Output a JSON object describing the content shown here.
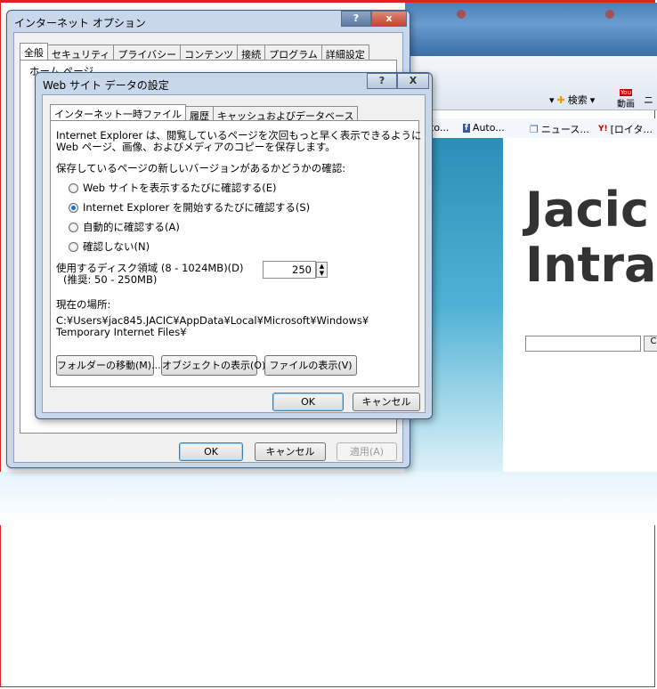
{
  "browser": {
    "cmd_search": "検索",
    "cmd_video": "動画",
    "cmd_more": "ニ",
    "favorites": [
      "to...",
      "Auto...",
      "ニュース...",
      "[ロイタ..."
    ],
    "hero_line1": "Jacic",
    "hero_line2": "Intrar",
    "search_button": "C"
  },
  "internet_options": {
    "title": "インターネット オプション",
    "help": "?",
    "close": "x",
    "tabs": [
      "全般",
      "セキュリティ",
      "プライバシー",
      "コンテンツ",
      "接続",
      "プログラム",
      "詳細設定"
    ],
    "homepage_label": "ホーム ページ",
    "ok": "OK",
    "cancel": "キャンセル",
    "apply": "適用(A)"
  },
  "site_data": {
    "title": "Web サイト データの設定",
    "help": "?",
    "close": "X",
    "tabs": [
      "インターネット一時ファイル",
      "履歴",
      "キャッシュおよびデータベース"
    ],
    "desc_line1": "Internet Explorer は、閲覧しているページを次回もっと早く表示できるように",
    "desc_line2": "Web ページ、画像、およびメディアのコピーを保存します。",
    "check_label": "保存しているページの新しいバージョンがあるかどうかの確認:",
    "options": [
      {
        "label": "Web サイトを表示するたびに確認する(E)",
        "selected": false
      },
      {
        "label": "Internet Explorer を開始するたびに確認する(S)",
        "selected": true
      },
      {
        "label": "自動的に確認する(A)",
        "selected": false
      },
      {
        "label": "確認しない(N)",
        "selected": false
      }
    ],
    "disk_label": "使用するディスク領域 (8 - 1024MB)(D)",
    "disk_recommended": "(推奨: 50 - 250MB)",
    "disk_value": "250",
    "location_label": "現在の場所:",
    "location_line1": "C:¥Users¥jac845.JACIC¥AppData¥Local¥Microsoft¥Windows¥",
    "location_line2": "Temporary Internet Files¥",
    "move_folder": "フォルダーの移動(M)...",
    "view_objects": "オブジェクトの表示(O)",
    "view_files": "ファイルの表示(V)",
    "ok": "OK",
    "cancel": "キャンセル"
  }
}
